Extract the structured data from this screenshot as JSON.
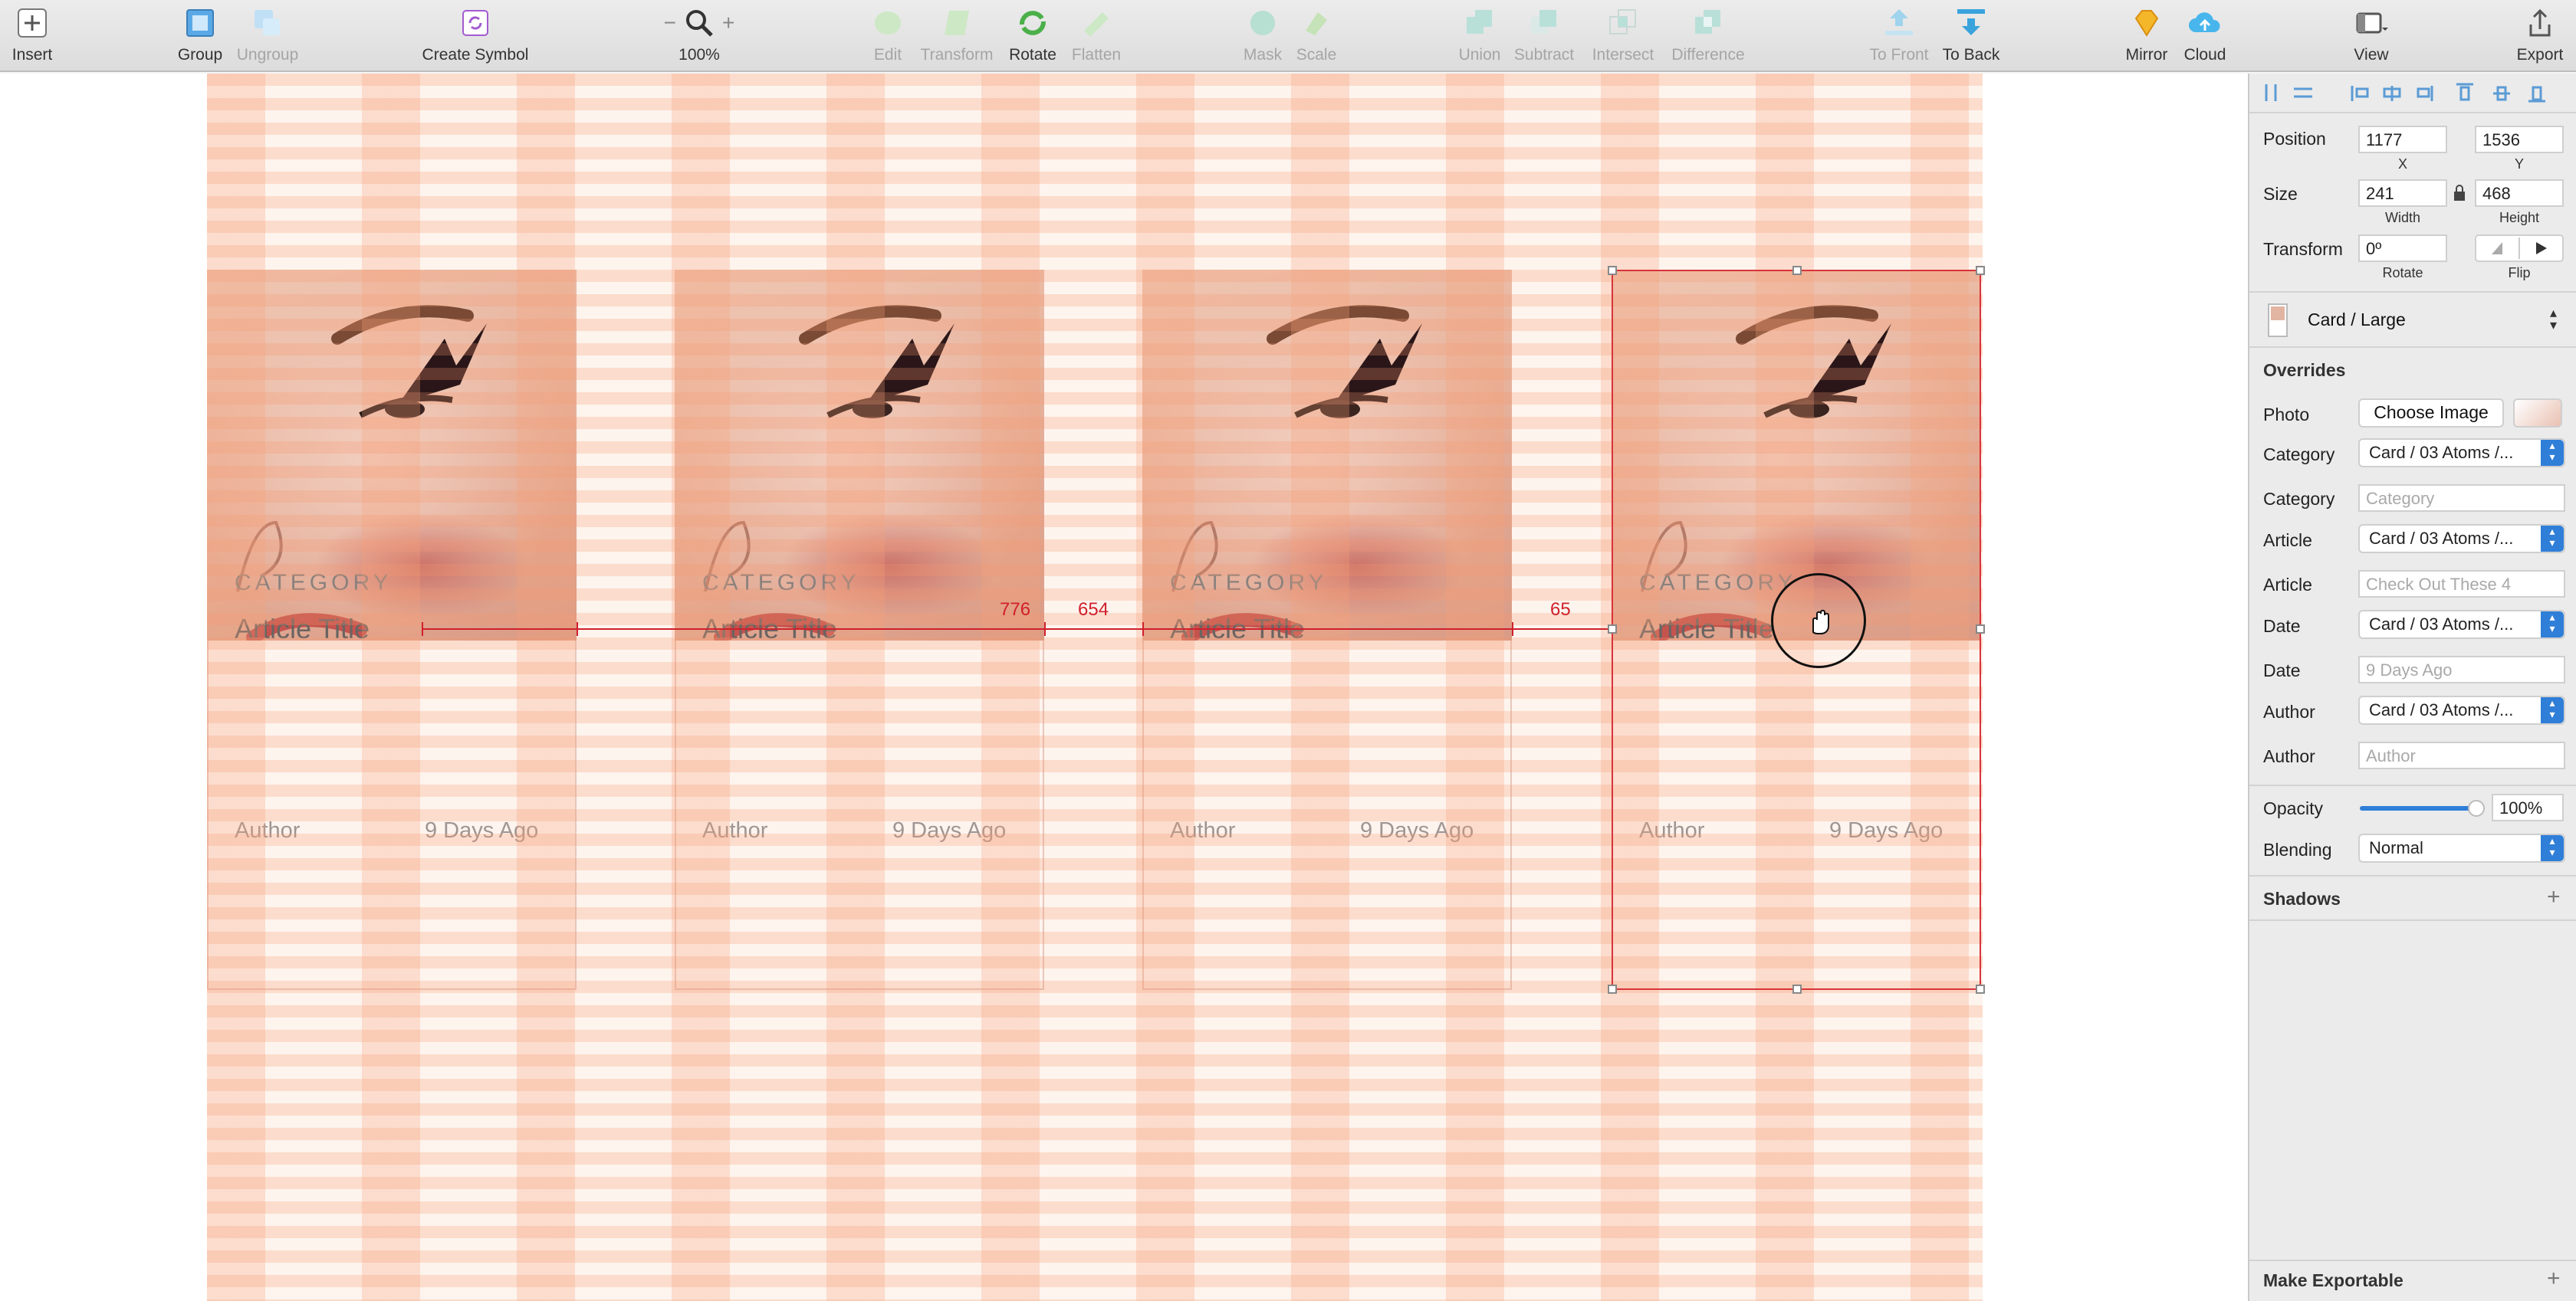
{
  "toolbar": {
    "insert": "Insert",
    "group": "Group",
    "ungroup": "Ungroup",
    "create_symbol": "Create Symbol",
    "zoom": "100%",
    "edit": "Edit",
    "transform": "Transform",
    "rotate": "Rotate",
    "flatten": "Flatten",
    "mask": "Mask",
    "scale": "Scale",
    "union": "Union",
    "subtract": "Subtract",
    "intersect": "Intersect",
    "difference": "Difference",
    "to_front": "To Front",
    "to_back": "To Back",
    "mirror": "Mirror",
    "cloud": "Cloud",
    "view": "View",
    "export": "Export",
    "zoom_minus": "−",
    "zoom_plus": "+"
  },
  "cards": [
    {
      "category": "CATEGORY",
      "title": "Article Title",
      "author": "Author",
      "date": "9 Days Ago"
    },
    {
      "category": "CATEGORY",
      "title": "Article Title",
      "author": "Author",
      "date": "9 Days Ago"
    },
    {
      "category": "CATEGORY",
      "title": "Article Title",
      "author": "Author",
      "date": "9 Days Ago"
    },
    {
      "category": "CATEGORY",
      "title": "Article Title",
      "author": "Author",
      "date": "9 Days Ago"
    }
  ],
  "measurements": {
    "a": "776",
    "b": "654",
    "c": "65"
  },
  "inspector": {
    "position_label": "Position",
    "x": "1177",
    "y": "1536",
    "x_label": "X",
    "y_label": "Y",
    "size_label": "Size",
    "width": "241",
    "height": "468",
    "width_label": "Width",
    "height_label": "Height",
    "transform_label": "Transform",
    "rotate_value": "0º",
    "rotate_label": "Rotate",
    "flip_label": "Flip",
    "symbol_name": "Card / Large",
    "overrides_title": "Overrides",
    "photo_label": "Photo",
    "choose_image": "Choose Image",
    "category_label": "Category",
    "category_symbol": "Card / 03 Atoms /...",
    "category_text_placeholder": "Category",
    "article_label": "Article",
    "article_symbol": "Card / 03 Atoms /...",
    "article_text_placeholder": "Check Out These 4",
    "date_label": "Date",
    "date_symbol": "Card / 03 Atoms /...",
    "date_text_placeholder": "9 Days Ago",
    "author_label": "Author",
    "author_symbol": "Card / 03 Atoms /...",
    "author_text_placeholder": "Author",
    "opacity_label": "Opacity",
    "opacity_value": "100%",
    "opacity_level": 1.0,
    "blending_label": "Blending",
    "blending_value": "Normal",
    "shadows": "Shadows",
    "make_exportable": "Make Exportable"
  },
  "colors": {
    "selection": "#d8343b",
    "grid": "#f6a078",
    "accent": "#2f7ed8"
  }
}
